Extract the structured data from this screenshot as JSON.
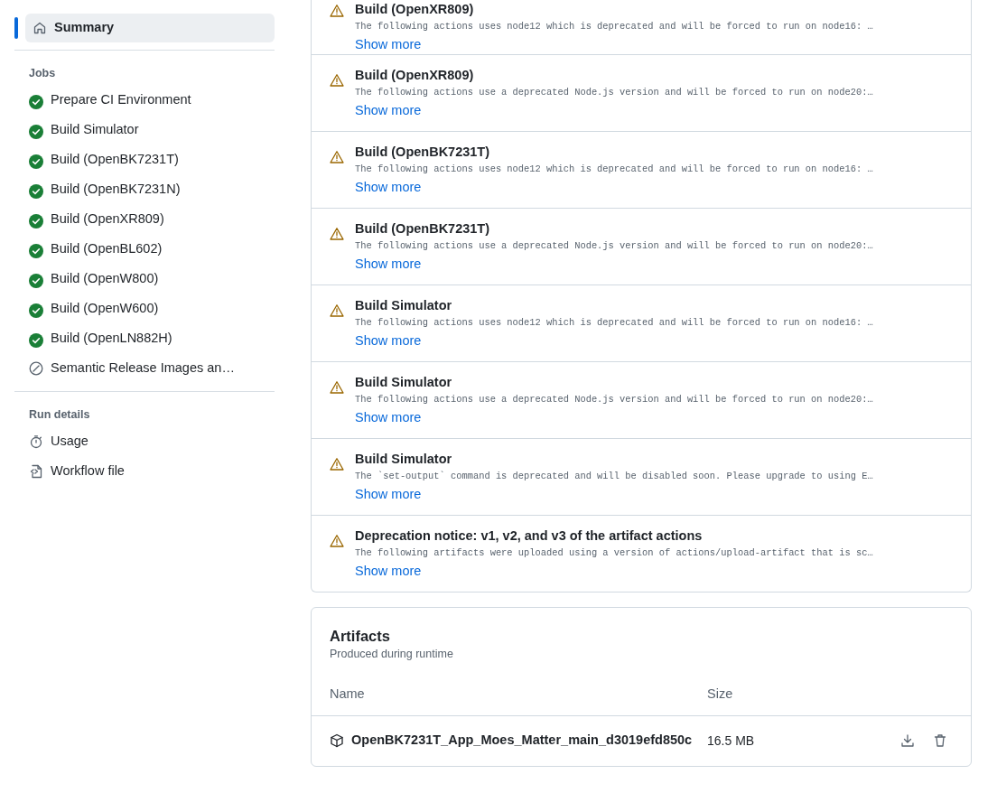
{
  "sidebar": {
    "summary": {
      "label": "Summary",
      "selected": true
    },
    "jobs_heading": "Jobs",
    "jobs": [
      {
        "label": "Prepare CI Environment",
        "kind": "success"
      },
      {
        "label": "Build Simulator",
        "kind": "success"
      },
      {
        "label": "Build (OpenBK7231T)",
        "kind": "success"
      },
      {
        "label": "Build (OpenBK7231N)",
        "kind": "success"
      },
      {
        "label": "Build (OpenXR809)",
        "kind": "success"
      },
      {
        "label": "Build (OpenBL602)",
        "kind": "success"
      },
      {
        "label": "Build (OpenW800)",
        "kind": "success"
      },
      {
        "label": "Build (OpenW600)",
        "kind": "success"
      },
      {
        "label": "Build (OpenLN882H)",
        "kind": "success"
      },
      {
        "label": "Semantic Release Images an…",
        "kind": "skipped"
      }
    ],
    "run_details_heading": "Run details",
    "run_details": [
      {
        "label": "Usage",
        "kind": "usage"
      },
      {
        "label": "Workflow file",
        "kind": "workflow"
      }
    ]
  },
  "annotations": [
    {
      "title": "Build (OpenXR809)",
      "message": "The following actions uses node12 which is deprecated and will be forced to run on node16: …",
      "link": "Show more"
    },
    {
      "title": "Build (OpenXR809)",
      "message": "The following actions use a deprecated Node.js version and will be forced to run on node20:…",
      "link": "Show more"
    },
    {
      "title": "Build (OpenBK7231T)",
      "message": "The following actions uses node12 which is deprecated and will be forced to run on node16: …",
      "link": "Show more"
    },
    {
      "title": "Build (OpenBK7231T)",
      "message": "The following actions use a deprecated Node.js version and will be forced to run on node20:…",
      "link": "Show more"
    },
    {
      "title": "Build Simulator",
      "message": "The following actions uses node12 which is deprecated and will be forced to run on node16: …",
      "link": "Show more"
    },
    {
      "title": "Build Simulator",
      "message": "The following actions use a deprecated Node.js version and will be forced to run on node20:…",
      "link": "Show more"
    },
    {
      "title": "Build Simulator",
      "message": "The `set-output` command is deprecated and will be disabled soon. Please upgrade to using E…",
      "link": "Show more"
    },
    {
      "title": "Deprecation notice: v1, v2, and v3 of the artifact actions",
      "message": "The following artifacts were uploaded using a version of actions/upload-artifact that is sc…",
      "link": "Show more"
    }
  ],
  "artifacts": {
    "title": "Artifacts",
    "subtitle": "Produced during runtime",
    "columns": [
      "Name",
      "Size"
    ],
    "rows": [
      {
        "name": "OpenBK7231T_App_Moes_Matter_main_d3019efd850c",
        "size": "16.5 MB"
      }
    ]
  }
}
